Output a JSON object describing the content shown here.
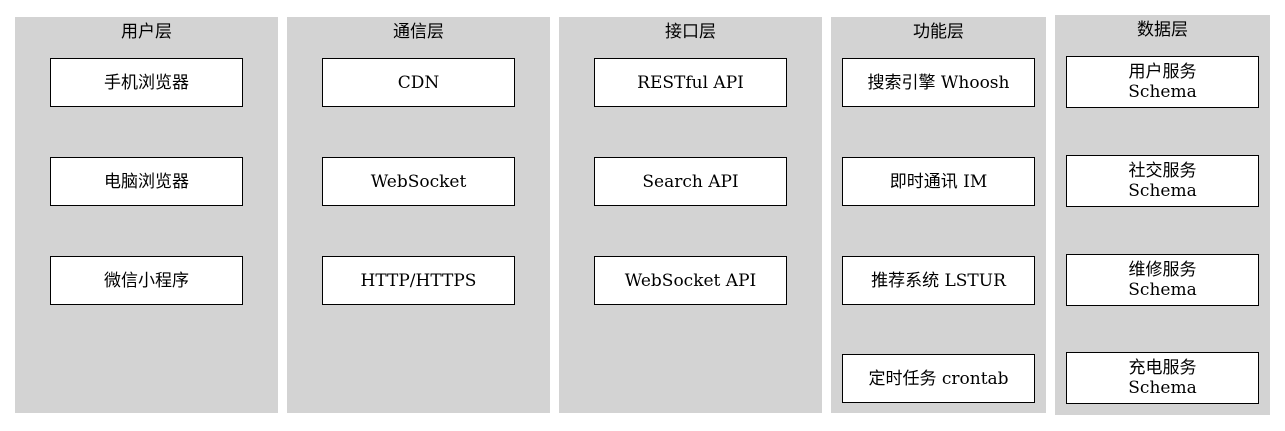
{
  "layers": [
    {
      "title": "用户层",
      "nodes": [
        {
          "label": "手机浏览器"
        },
        {
          "label": "电脑浏览器"
        },
        {
          "label": "微信小程序"
        }
      ]
    },
    {
      "title": "通信层",
      "nodes": [
        {
          "label": "CDN"
        },
        {
          "label": "WebSocket"
        },
        {
          "label": "HTTP/HTTPS"
        }
      ]
    },
    {
      "title": "接口层",
      "nodes": [
        {
          "label": "RESTful API"
        },
        {
          "label": "Search API"
        },
        {
          "label": "WebSocket API"
        }
      ]
    },
    {
      "title": "功能层",
      "nodes": [
        {
          "label": "搜索引擎 Whoosh"
        },
        {
          "label": "即时通讯 IM"
        },
        {
          "label": "推荐系统 LSTUR"
        },
        {
          "label": "定时任务 crontab"
        }
      ]
    },
    {
      "title": "数据层",
      "nodes": [
        {
          "label": "用户服务",
          "label2": "Schema"
        },
        {
          "label": "社交服务",
          "label2": "Schema"
        },
        {
          "label": "维修服务",
          "label2": "Schema"
        },
        {
          "label": "充电服务",
          "label2": "Schema"
        }
      ]
    }
  ]
}
